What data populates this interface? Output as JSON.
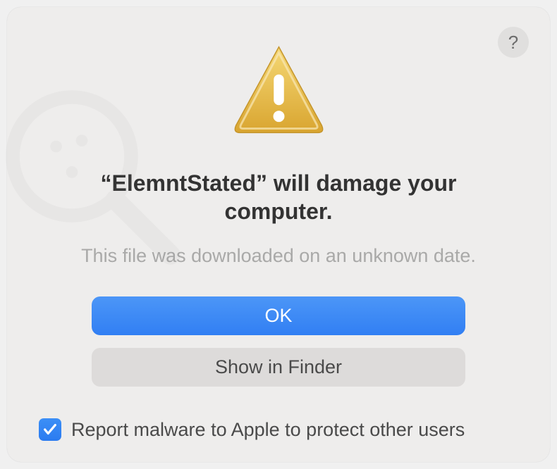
{
  "help_button_label": "?",
  "title": "“ElemntStated” will damage your computer.",
  "subtitle": "This file was downloaded on an unknown date.",
  "buttons": {
    "ok_label": "OK",
    "show_in_finder_label": "Show in Finder"
  },
  "checkbox": {
    "checked": true,
    "label": "Report malware to Apple to protect other users"
  },
  "colors": {
    "primary_button": "#317ff3",
    "secondary_button": "#dddbda",
    "dialog_bg": "#eeedec",
    "text_dark": "#333333",
    "text_muted": "#a9a9a8"
  }
}
